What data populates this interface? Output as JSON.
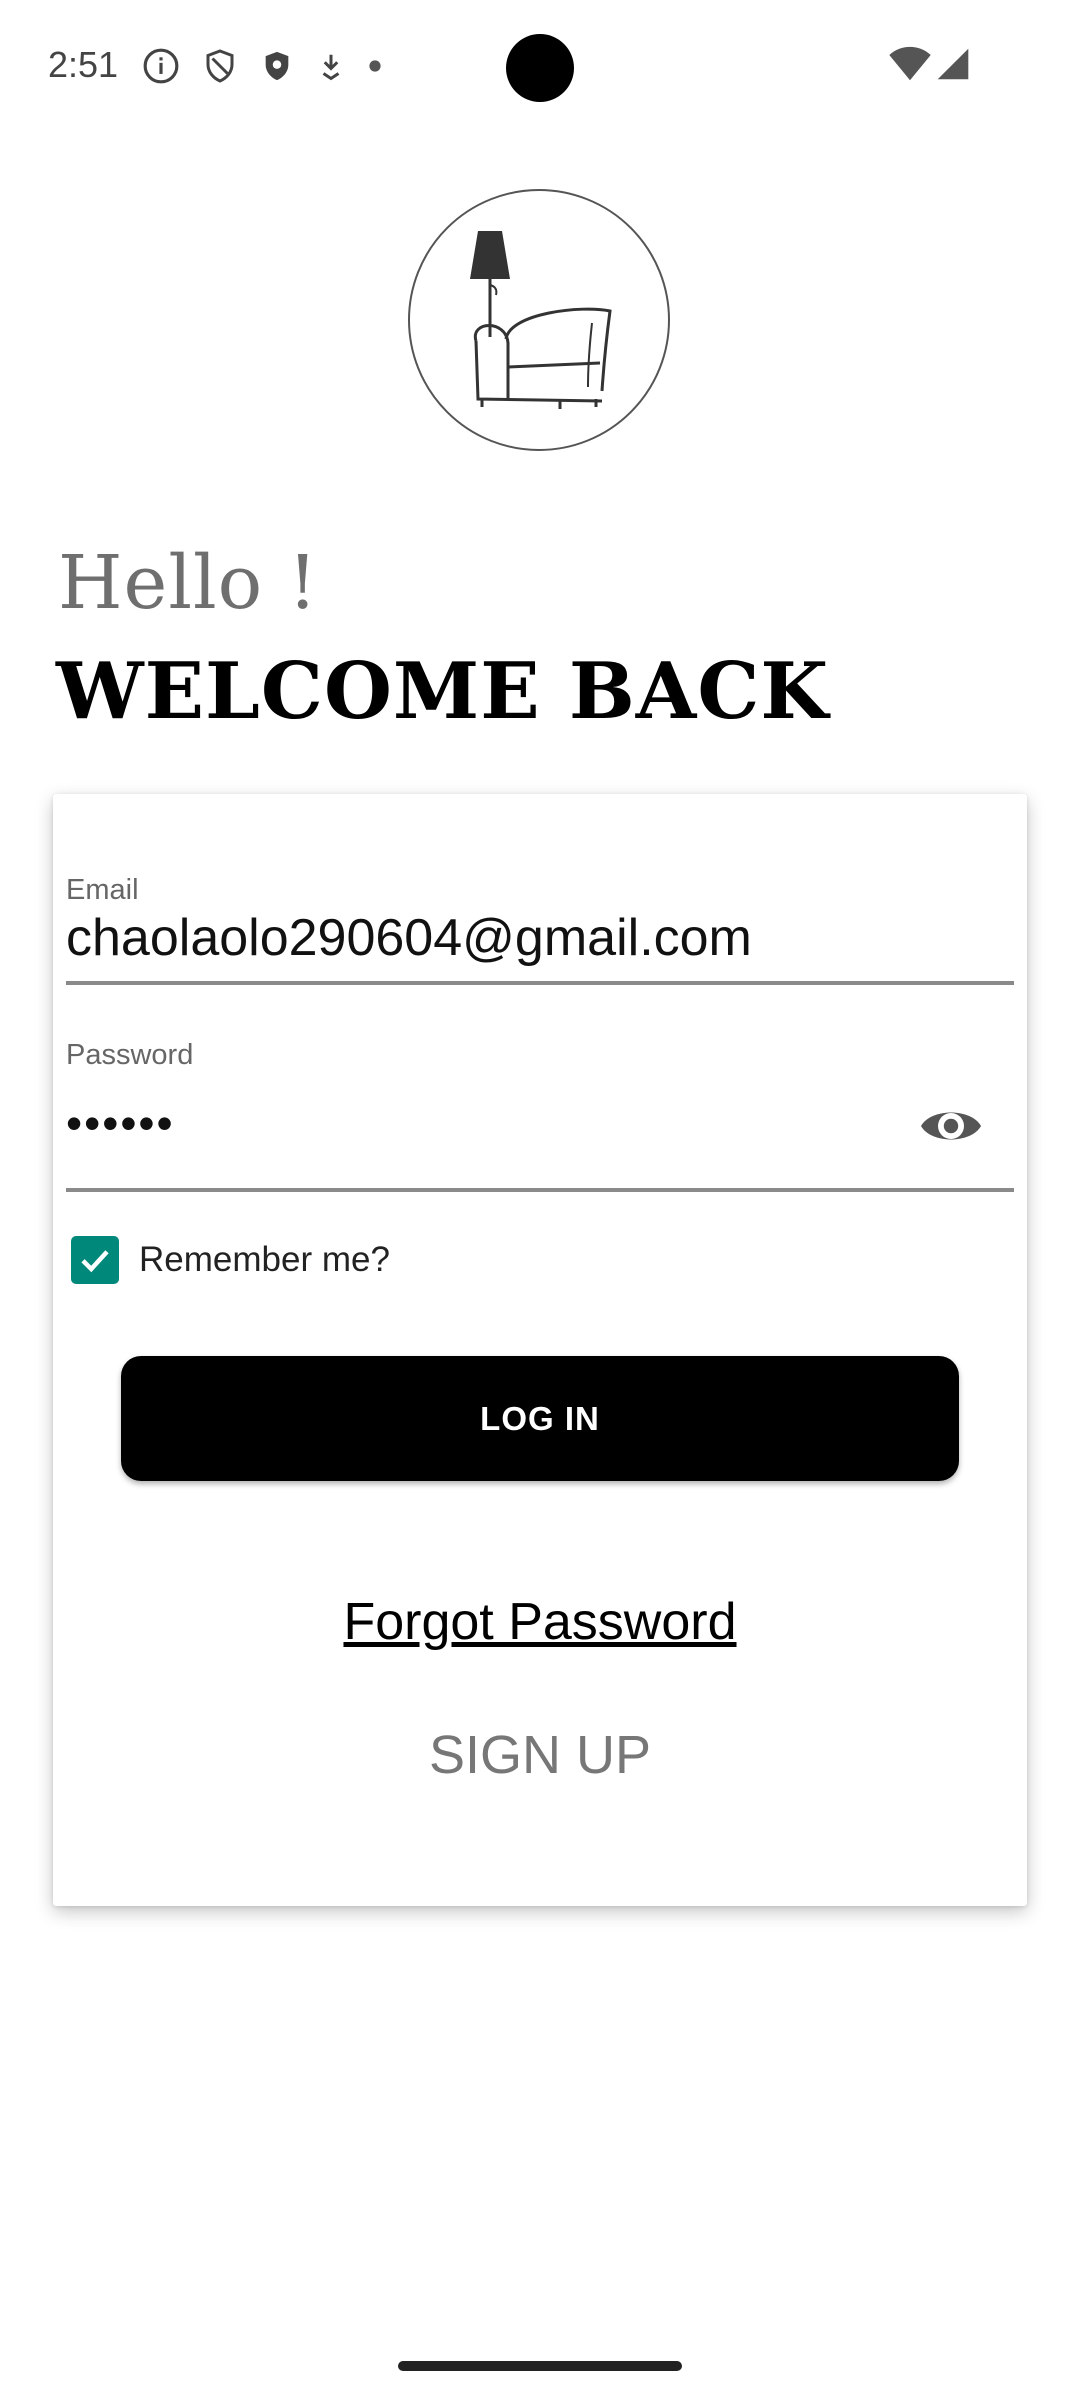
{
  "status_bar": {
    "time": "2:51",
    "left_icons": [
      "info-icon",
      "shield-outline-icon",
      "shield-filled-icon",
      "download-icon",
      "dot-icon"
    ],
    "right_icons": [
      "wifi-icon",
      "signal-icon"
    ]
  },
  "logo": {
    "icon": "armchair-lamp-logo"
  },
  "greeting": {
    "hello": "Hello !",
    "welcome": "WELCOME BACK"
  },
  "form": {
    "email_label": "Email",
    "email_value": "chaolaolo290604@gmail.com",
    "password_label": "Password",
    "password_value": "••••••",
    "password_toggle_icon": "eye-icon",
    "remember_label": "Remember me?",
    "remember_checked": true,
    "login_label": "LOG IN",
    "forgot_label": "Forgot Password",
    "signup_label": "SIGN UP"
  },
  "colors": {
    "accent_checkbox": "#00897b",
    "button_bg": "#000000",
    "hello_text": "#6f6f6f",
    "signup_text": "#777777"
  }
}
